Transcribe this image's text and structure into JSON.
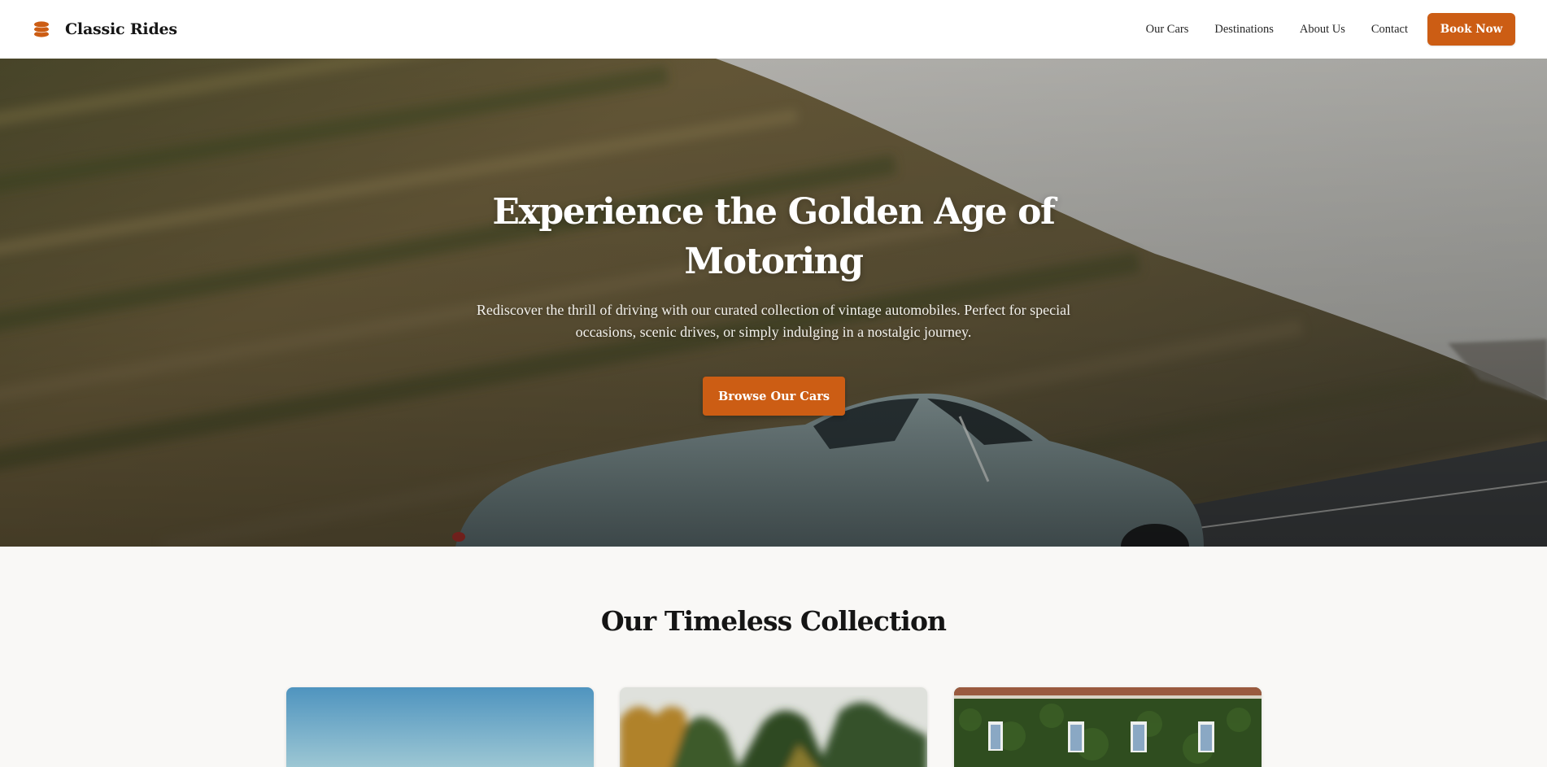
{
  "brand": {
    "name": "Classic Rides",
    "icon": "stacked-layers-icon",
    "accent_color": "#cc5d14"
  },
  "nav": {
    "links": [
      {
        "label": "Our Cars"
      },
      {
        "label": "Destinations"
      },
      {
        "label": "About Us"
      },
      {
        "label": "Contact"
      }
    ],
    "cta_label": "Book Now"
  },
  "hero": {
    "title": "Experience the Golden Age of Motoring",
    "subtitle": "Rediscover the thrill of driving with our curated collection of vintage automobiles. Perfect for special occasions, scenic drives, or simply indulging in a nostalgic journey.",
    "cta_label": "Browse Our Cars",
    "image": "vintage-sports-car-on-hillside-road-photo"
  },
  "collection": {
    "title": "Our Timeless Collection",
    "cards": [
      {
        "image": "blue-sky-photo"
      },
      {
        "image": "blurred-trees-photo"
      },
      {
        "image": "ivy-covered-villa-photo"
      }
    ]
  }
}
